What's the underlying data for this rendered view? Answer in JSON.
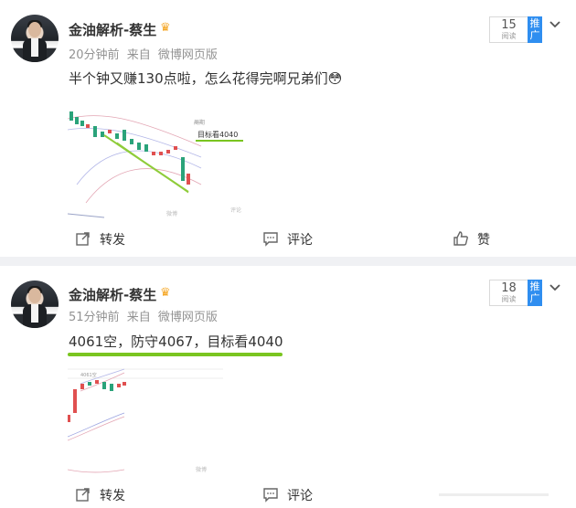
{
  "posts": [
    {
      "username": "金油解析-蔡生",
      "time": "20分钟前",
      "source_prefix": "来自",
      "source": "微博网页版",
      "text": "半个钟又赚130点啦，怎么花得完啊兄弟们",
      "emoji": "😳",
      "read_count": "15",
      "read_label": "阅读",
      "promote_label": "推广",
      "image_caption": "目标看4040",
      "actions": {
        "repost": "转发",
        "comment": "评论",
        "like": "赞"
      }
    },
    {
      "username": "金油解析-蔡生",
      "time": "51分钟前",
      "source_prefix": "来自",
      "source": "微博网页版",
      "text": "4061空，防守4067，目标看4040",
      "read_count": "18",
      "read_label": "阅读",
      "promote_label": "推广",
      "actions": {
        "repost": "转发",
        "comment": "评论"
      }
    }
  ],
  "colors": {
    "accent_green": "#7ac520",
    "promote_blue": "#2f8ef0",
    "meta_gray": "#939393",
    "background": "#f0f1f4"
  }
}
